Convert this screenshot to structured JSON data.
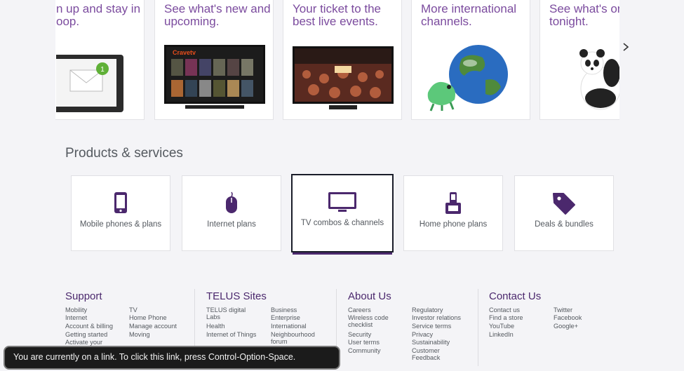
{
  "carousel": {
    "cards": [
      {
        "text": "n up and stay in\noop."
      },
      {
        "text": "See what's new and upcoming.",
        "image_caption": "Cravetv"
      },
      {
        "text": "Your ticket to the best live events."
      },
      {
        "text": "More international channels."
      },
      {
        "text": "See what's on TV tonight."
      }
    ],
    "next_icon": "chevron-right-icon"
  },
  "products": {
    "title": "Products & services",
    "tiles": [
      {
        "label": "Mobile phones & plans",
        "icon": "mobile-phone-icon"
      },
      {
        "label": "Internet plans",
        "icon": "mouse-icon"
      },
      {
        "label": "TV combos & channels",
        "icon": "tv-icon"
      },
      {
        "label": "Home phone plans",
        "icon": "home-phone-icon"
      },
      {
        "label": "Deals & bundles",
        "icon": "tag-icon"
      }
    ]
  },
  "footer": {
    "support": {
      "title": "Support",
      "col1": [
        "Mobility",
        "Internet",
        "Account & billing",
        "Getting started",
        "Activate your"
      ],
      "col2": [
        "TV",
        "Home Phone",
        "Manage account",
        "Moving"
      ]
    },
    "sites": {
      "title": "TELUS Sites",
      "col1": [
        "TELUS digital\nLabs",
        "Health",
        "Internet of Things"
      ],
      "col2": [
        "Business",
        "Enterprise",
        "International",
        "Neighbourhood\nforum"
      ]
    },
    "about": {
      "title": "About Us",
      "col1": [
        "Careers",
        "Wireless code\nchecklist",
        "Security",
        "User terms",
        "Community"
      ],
      "col2": [
        "Regulatory",
        "Investor relations",
        "Service terms",
        "Privacy",
        "Sustainability",
        "Customer\nFeedback"
      ]
    },
    "contact": {
      "title": "Contact Us",
      "col1": [
        "Contact us",
        "Find a store",
        "YouTube",
        "LinkedIn"
      ],
      "col2": [
        "Twitter",
        "Facebook",
        "Google+"
      ]
    }
  },
  "voiceover": {
    "message": "You are currently on a link. To click this link, press Control-Option-Space."
  },
  "colors": {
    "brand": "#4b286d",
    "accent": "#7b4b9e",
    "background": "#f4f4f7"
  }
}
